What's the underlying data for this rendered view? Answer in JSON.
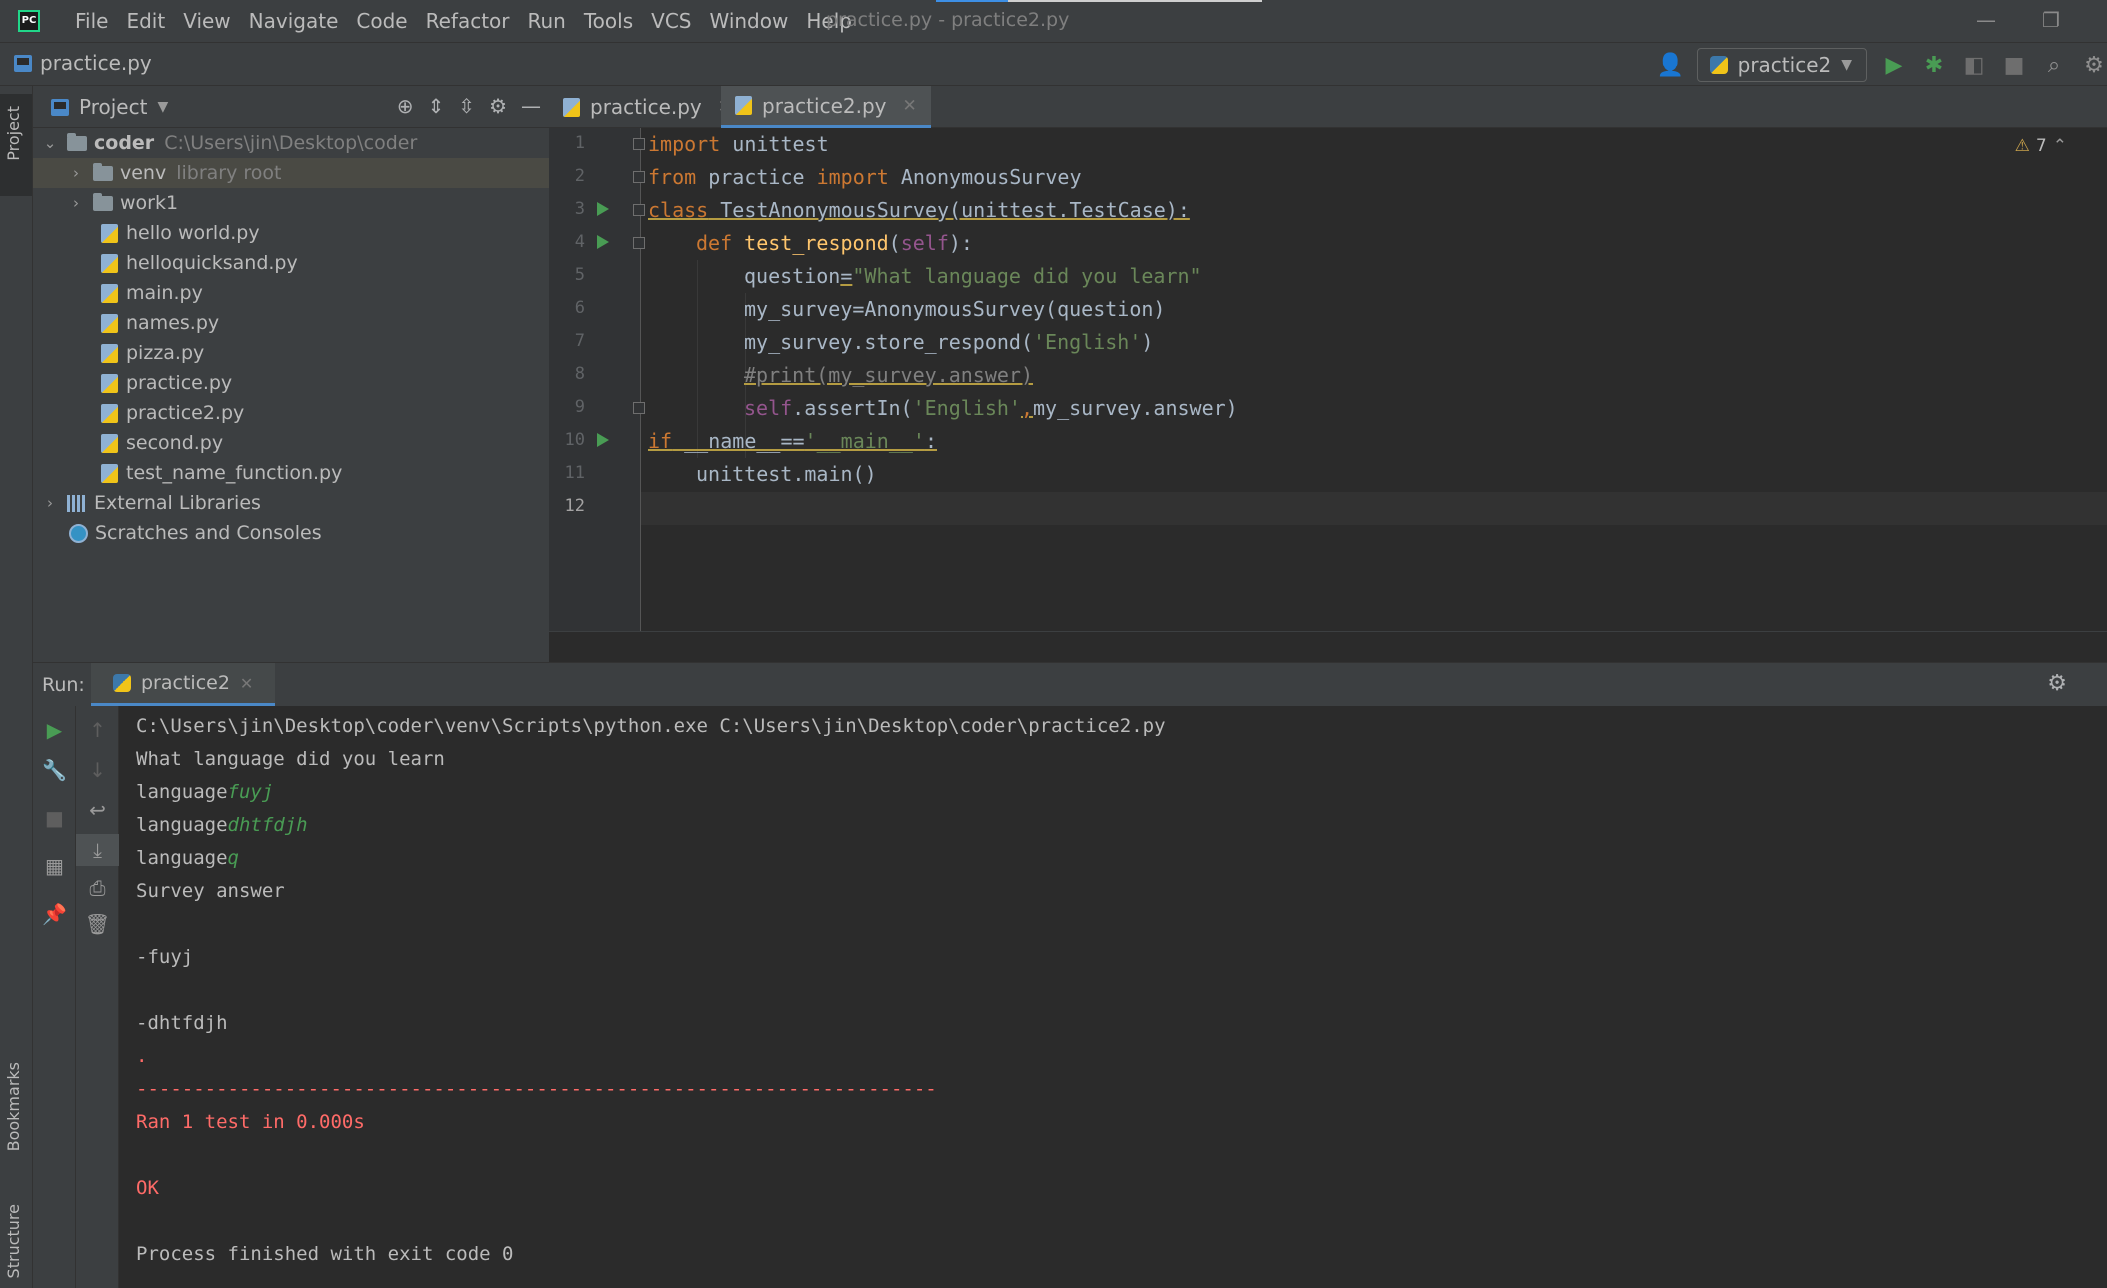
{
  "window": {
    "title": "practice.py - practice2.py",
    "menu": [
      "File",
      "Edit",
      "View",
      "Navigate",
      "Code",
      "Refactor",
      "Run",
      "Tools",
      "VCS",
      "Window",
      "Help"
    ]
  },
  "navbar": {
    "breadcrumb": "practice.py",
    "run_config": "practice2"
  },
  "left_stripe": {
    "top": "Project",
    "bottom1": "Bookmarks",
    "bottom2": "Structure"
  },
  "project": {
    "title": "Project",
    "root": {
      "name": "coder",
      "path": "C:\\Users\\jin\\Desktop\\coder"
    },
    "items": [
      {
        "name": "venv",
        "hint": "library root",
        "kind": "folder"
      },
      {
        "name": "work1",
        "kind": "folder"
      },
      {
        "name": "hello world.py",
        "kind": "py"
      },
      {
        "name": "helloquicksand.py",
        "kind": "py"
      },
      {
        "name": "main.py",
        "kind": "py"
      },
      {
        "name": "names.py",
        "kind": "py"
      },
      {
        "name": "pizza.py",
        "kind": "py"
      },
      {
        "name": "practice.py",
        "kind": "py"
      },
      {
        "name": "practice2.py",
        "kind": "py"
      },
      {
        "name": "second.py",
        "kind": "py"
      },
      {
        "name": "test_name_function.py",
        "kind": "py"
      }
    ],
    "external_libraries": "External Libraries",
    "scratches": "Scratches and Consoles"
  },
  "editor": {
    "tabs": [
      "practice.py",
      "practice2.py"
    ],
    "active_tab": "practice2.py",
    "warning_count": "7",
    "line_numbers": [
      "1",
      "2",
      "3",
      "4",
      "5",
      "6",
      "7",
      "8",
      "9",
      "10",
      "11",
      "12"
    ],
    "code": {
      "l1_kw": "import",
      "l1_rest": " unittest",
      "l2_kw1": "from",
      "l2_mid": " practice ",
      "l2_kw2": "import",
      "l2_rest": " AnonymousSurvey",
      "l3_kw": "class",
      "l3_rest": " TestAnonymousSurvey(unittest.TestCase):",
      "l4_kw": "def",
      "l4_fn": "test_respond",
      "l4_open": "(",
      "l4_self": "self",
      "l4_close": "):",
      "l5_a": "question",
      "l5_eq": "=",
      "l5_str": "\"What language did you learn\"",
      "l6": "my_survey=AnonymousSurvey(question)",
      "l7_a": "my_survey.store_respond(",
      "l7_str": "'English'",
      "l7_b": ")",
      "l8": "#print(my_survey.answer)",
      "l9_self": "self",
      "l9_a": ".assertIn(",
      "l9_str": "'English'",
      "l9_comma": ",",
      "l9_b": "my_survey.answer)",
      "l10_kw": "if",
      "l10_a": " __name__==",
      "l10_str": "'__main__'",
      "l10_b": ":",
      "l11": "unittest.main()"
    }
  },
  "run": {
    "label": "Run:",
    "tab": "practice2",
    "console": {
      "cmd": "C:\\Users\\jin\\Desktop\\coder\\venv\\Scripts\\python.exe C:\\Users\\jin\\Desktop\\coder\\practice2.py",
      "prompt": "What language did you learn",
      "lang_label": "language",
      "inputs": [
        "fuyj",
        "dhtfdjh",
        "q"
      ],
      "survey": "Survey answer",
      "ans1": "-fuyj",
      "ans2": "-dhtfdjh",
      "dot": ".",
      "sep": "----------------------------------------------------------------------",
      "ran": "Ran 1 test in 0.000s",
      "ok": "OK",
      "finished": "Process finished with exit code 0"
    }
  },
  "colors": {
    "keyword": "#cc7832",
    "string": "#6a8759",
    "self": "#94558d",
    "function": "#ffc66d",
    "error": "#ff6b68",
    "input": "#499c54",
    "accent": "#4a88c7"
  }
}
